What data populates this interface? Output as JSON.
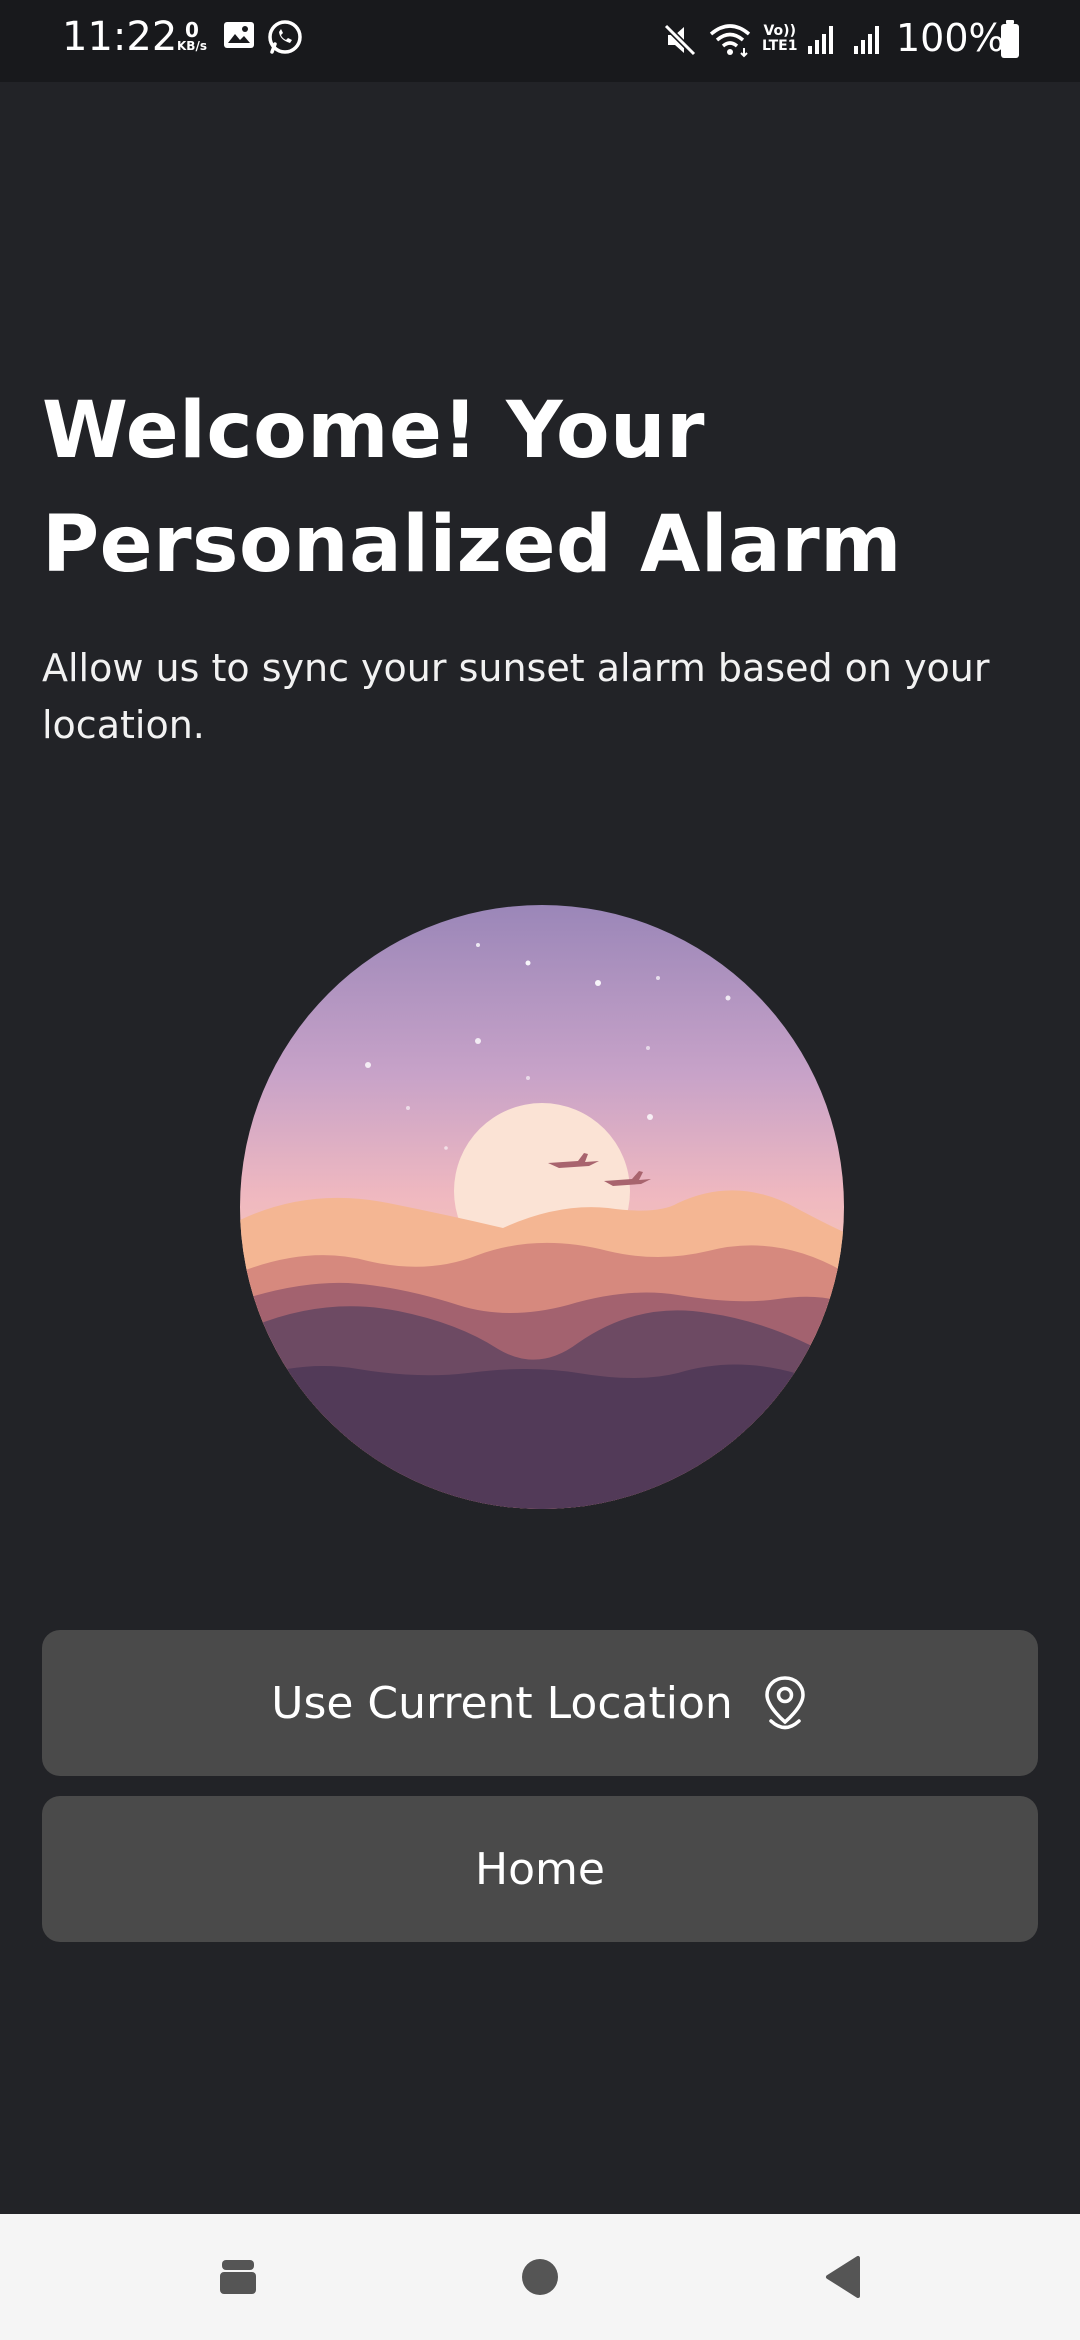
{
  "status_bar": {
    "time": "11:22",
    "net_speed_value": "0",
    "net_speed_unit": "KB/s",
    "volte_top": "Vo))",
    "volte_bottom": "LTE1",
    "battery": "100%",
    "icons": [
      "gallery-icon",
      "whatsapp-icon",
      "mute-icon",
      "wifi-icon",
      "signal-icon",
      "signal-icon",
      "battery-icon"
    ]
  },
  "main": {
    "headline_line1": "Welcome! Your",
    "headline_line2": "Personalized Alarm",
    "subtitle": "Allow us to sync your sunset alarm based on your location."
  },
  "buttons": {
    "use_location_label": "Use Current Location",
    "home_label": "Home"
  },
  "nav_bar": {
    "icons": [
      "recents-icon",
      "home-circle-icon",
      "back-triangle-icon"
    ]
  },
  "colors": {
    "background": "#222327",
    "button": "#4a4a4a",
    "nav_bar": "#f5f5f5"
  }
}
